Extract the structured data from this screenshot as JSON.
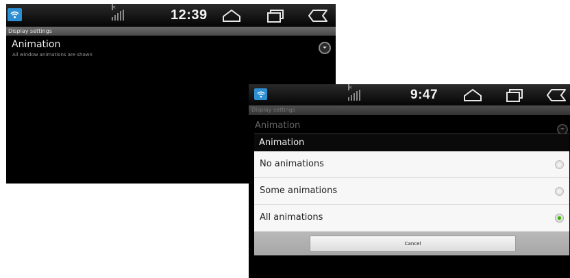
{
  "screen1": {
    "status_bar": {
      "time": "12:39",
      "signal_x": "×"
    },
    "title_bar": "Display settings",
    "setting": {
      "title": "Animation",
      "summary": "All window animations are shown"
    }
  },
  "screen2": {
    "status_bar": {
      "time": "9:47",
      "signal_x": "×"
    },
    "title_bar": "Display settings",
    "setting": {
      "title": "Animation"
    },
    "dialog": {
      "title": "Animation",
      "options": [
        {
          "label": "No animations",
          "selected": false
        },
        {
          "label": "Some animations",
          "selected": false
        },
        {
          "label": "All animations",
          "selected": true
        }
      ],
      "cancel_label": "Cancel"
    }
  },
  "colors": {
    "wifi_icon": "#2c8fd3",
    "radio_selected": "#33b000"
  },
  "icons": [
    "wifi-icon",
    "signal-icon",
    "home-icon",
    "recent-apps-icon",
    "back-icon",
    "dropdown-icon"
  ]
}
